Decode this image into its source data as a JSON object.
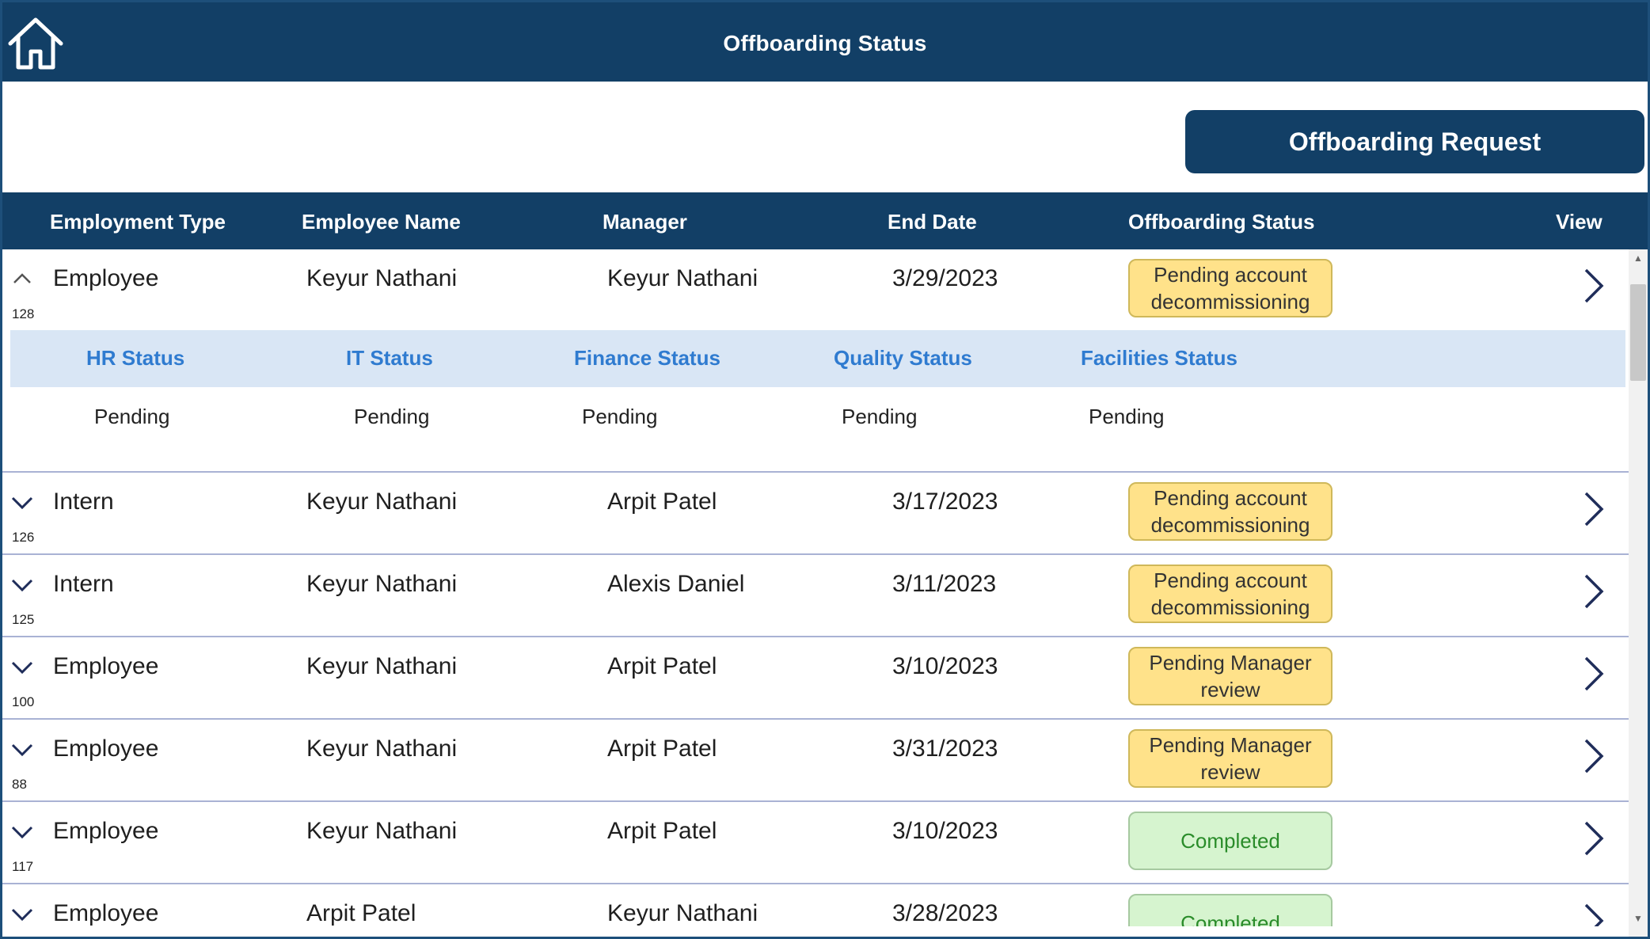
{
  "header": {
    "title": "Offboarding Status",
    "home_icon": "home-icon"
  },
  "actions": {
    "request_label": "Offboarding Request"
  },
  "table": {
    "columns": [
      "Employment Type",
      "Employee Name",
      "Manager",
      "End Date",
      "Offboarding Status",
      "View"
    ],
    "expanded": {
      "headers": [
        "HR Status",
        "IT Status",
        "Finance Status",
        "Quality Status",
        "Facilities Status"
      ],
      "values": [
        "Pending",
        "Pending",
        "Pending",
        "Pending",
        "Pending"
      ]
    },
    "rows": [
      {
        "id": "128",
        "type": "Employee",
        "name": "Keyur Nathani",
        "manager": "Keyur Nathani",
        "end_date": "3/29/2023",
        "status": "Pending account decommissioning",
        "status_kind": "pending",
        "expanded": true
      },
      {
        "id": "126",
        "type": "Intern",
        "name": "Keyur Nathani",
        "manager": "Arpit Patel",
        "end_date": "3/17/2023",
        "status": "Pending account decommissioning",
        "status_kind": "pending",
        "expanded": false
      },
      {
        "id": "125",
        "type": "Intern",
        "name": "Keyur Nathani",
        "manager": "Alexis Daniel",
        "end_date": "3/11/2023",
        "status": "Pending account decommissioning",
        "status_kind": "pending",
        "expanded": false
      },
      {
        "id": "100",
        "type": "Employee",
        "name": "Keyur Nathani",
        "manager": "Arpit Patel",
        "end_date": "3/10/2023",
        "status": "Pending Manager review",
        "status_kind": "pending",
        "expanded": false
      },
      {
        "id": "88",
        "type": "Employee",
        "name": "Keyur Nathani",
        "manager": "Arpit Patel",
        "end_date": "3/31/2023",
        "status": "Pending Manager review",
        "status_kind": "pending",
        "expanded": false
      },
      {
        "id": "117",
        "type": "Employee",
        "name": "Keyur Nathani",
        "manager": "Arpit Patel",
        "end_date": "3/10/2023",
        "status": "Completed",
        "status_kind": "done",
        "expanded": false
      },
      {
        "id": "",
        "type": "Employee",
        "name": "Arpit Patel",
        "manager": "Keyur Nathani",
        "end_date": "3/28/2023",
        "status": "Completed",
        "status_kind": "done",
        "expanded": false
      }
    ]
  },
  "colors": {
    "primary": "#123f66",
    "pending_bg": "#ffe28a",
    "done_bg": "#d6f4cf",
    "done_text": "#2a8c2a",
    "expand_bg": "#d9e6f5",
    "expand_text": "#2f7bd0"
  }
}
